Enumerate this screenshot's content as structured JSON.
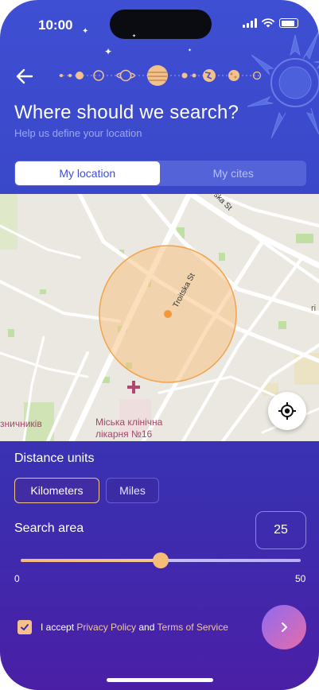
{
  "status_bar": {
    "time": "10:00"
  },
  "header": {
    "title": "Where should we search?",
    "subtitle": "Help us define your location"
  },
  "tabs": [
    {
      "label": "My location",
      "active": true
    },
    {
      "label": "My cites",
      "active": false
    }
  ],
  "map": {
    "street_labels": [
      "Troitska St",
      "ska St"
    ],
    "place_label_line1": "Міська клінічна",
    "place_label_line2": "лікарня №16",
    "edge_label_left": "зничників",
    "edge_label_right": "ri"
  },
  "distance": {
    "label": "Distance units",
    "options": [
      {
        "label": "Kilometers",
        "selected": true
      },
      {
        "label": "Miles",
        "selected": false
      }
    ]
  },
  "search_area": {
    "label": "Search area",
    "value": "25",
    "min_label": "0",
    "max_label": "50",
    "fraction": 0.5
  },
  "terms": {
    "prefix": "I accept ",
    "privacy_link": "Privacy Policy",
    "and": " and ",
    "terms_link": "Terms of Service",
    "checked": true
  },
  "colors": {
    "accent": "#f6bd79",
    "primary": "#3f4fd3",
    "link": "#f6c98e"
  }
}
